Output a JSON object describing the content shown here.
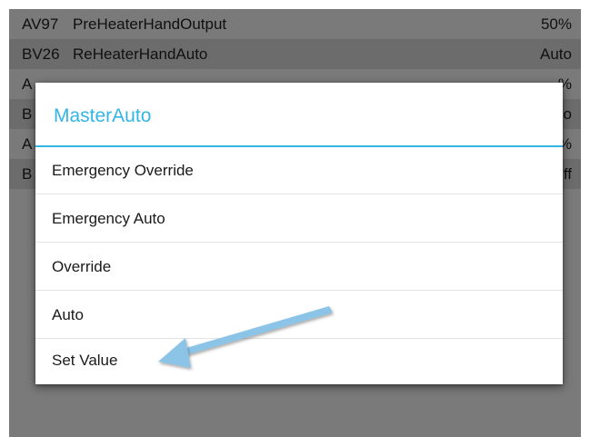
{
  "background_rows": [
    {
      "code": "AV97",
      "name": "PreHeaterHandOutput",
      "value": "50%"
    },
    {
      "code": "BV26",
      "name": "ReHeaterHandAuto",
      "value": "Auto"
    },
    {
      "code": "A",
      "name": "",
      "value": "%"
    },
    {
      "code": "B",
      "name": "",
      "value": "o"
    },
    {
      "code": "A",
      "name": "",
      "value": "%"
    },
    {
      "code": "B",
      "name": "",
      "value": "ff"
    }
  ],
  "dialog": {
    "title": "MasterAuto",
    "options": [
      {
        "label": "Emergency Override"
      },
      {
        "label": "Emergency Auto"
      },
      {
        "label": "Override"
      },
      {
        "label": "Auto"
      },
      {
        "label": "Set Value"
      }
    ]
  },
  "colors": {
    "accent": "#33b5e5",
    "annotation_arrow": "#8cc4e8"
  },
  "annotation": {
    "icon": "arrow-pointer-icon",
    "target": "Set Value"
  }
}
